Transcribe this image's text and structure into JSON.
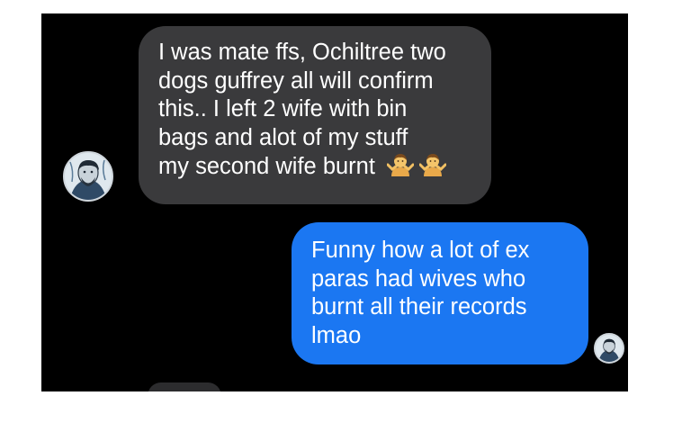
{
  "conversation": {
    "incoming": {
      "lines": [
        "I was mate ffs, Ochiltree two",
        "dogs guffrey all will confirm",
        "this.. I left 2 wife with bin",
        "bags and alot of my stuff",
        "my second wife burnt"
      ],
      "emoji": "person-shrugging-emoji",
      "emoji_count": 2,
      "avatar": "contact-avatar"
    },
    "outgoing": {
      "lines": [
        "Funny how a lot of ex",
        "paras had wives who",
        "burnt all their records",
        "lmao"
      ],
      "avatar": "own-avatar"
    }
  },
  "colors": {
    "background": "#000000",
    "incoming_bubble": "#3a3a3c",
    "outgoing_bubble": "#1b77f2",
    "text": "#ffffff"
  }
}
